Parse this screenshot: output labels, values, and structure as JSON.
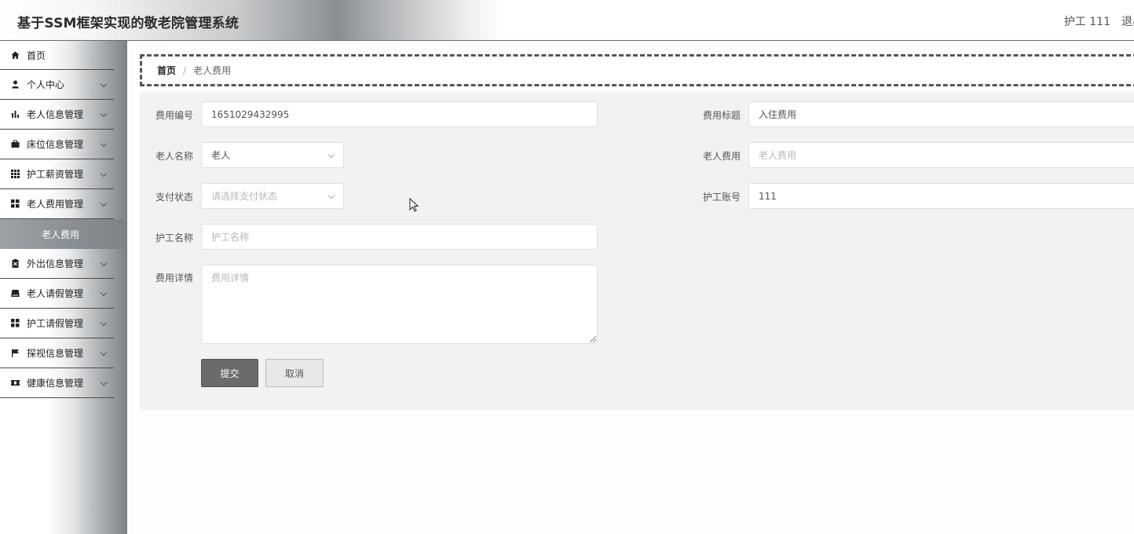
{
  "header": {
    "title": "基于SSM框架实现的敬老院管理系统",
    "user": "护工 111",
    "logout": "退出"
  },
  "sidebar": {
    "items": [
      {
        "label": "首页",
        "icon": "home-icon"
      },
      {
        "label": "个人中心",
        "icon": "user-icon"
      },
      {
        "label": "老人信息管理",
        "icon": "bar-chart-icon"
      },
      {
        "label": "床位信息管理",
        "icon": "briefcase-icon"
      },
      {
        "label": "护工薪资管理",
        "icon": "grid-icon"
      },
      {
        "label": "老人费用管理",
        "icon": "dashboard-icon"
      },
      {
        "label": "外出信息管理",
        "icon": "clipboard-icon"
      },
      {
        "label": "老人请假管理",
        "icon": "inbox-icon"
      },
      {
        "label": "护工请假管理",
        "icon": "dashboard-icon"
      },
      {
        "label": "探视信息管理",
        "icon": "flag-icon"
      },
      {
        "label": "健康信息管理",
        "icon": "ticket-icon"
      }
    ],
    "active_sub": "老人费用"
  },
  "breadcrumb": {
    "home": "首页",
    "separator": "/",
    "current": "老人费用"
  },
  "form": {
    "fee_no": {
      "label": "费用编号",
      "value": "1651029432995"
    },
    "fee_title": {
      "label": "费用标题",
      "value": "入住费用"
    },
    "elder_name": {
      "label": "老人名称",
      "value": "老人"
    },
    "elder_fee": {
      "label": "老人费用",
      "placeholder": "老人费用"
    },
    "pay_status": {
      "label": "支付状态",
      "placeholder": "请选择支付状态"
    },
    "nurse_account": {
      "label": "护工账号",
      "value": "111"
    },
    "nurse_name": {
      "label": "护工名称",
      "placeholder": "护工名称"
    },
    "fee_detail": {
      "label": "费用详情",
      "placeholder": "费用详情"
    },
    "submit_label": "提交",
    "cancel_label": "取消"
  },
  "colors": {
    "header_accent": "#8a8e93",
    "sidebar_active": "#7c8186",
    "submit_button": "#6b6b6b"
  }
}
